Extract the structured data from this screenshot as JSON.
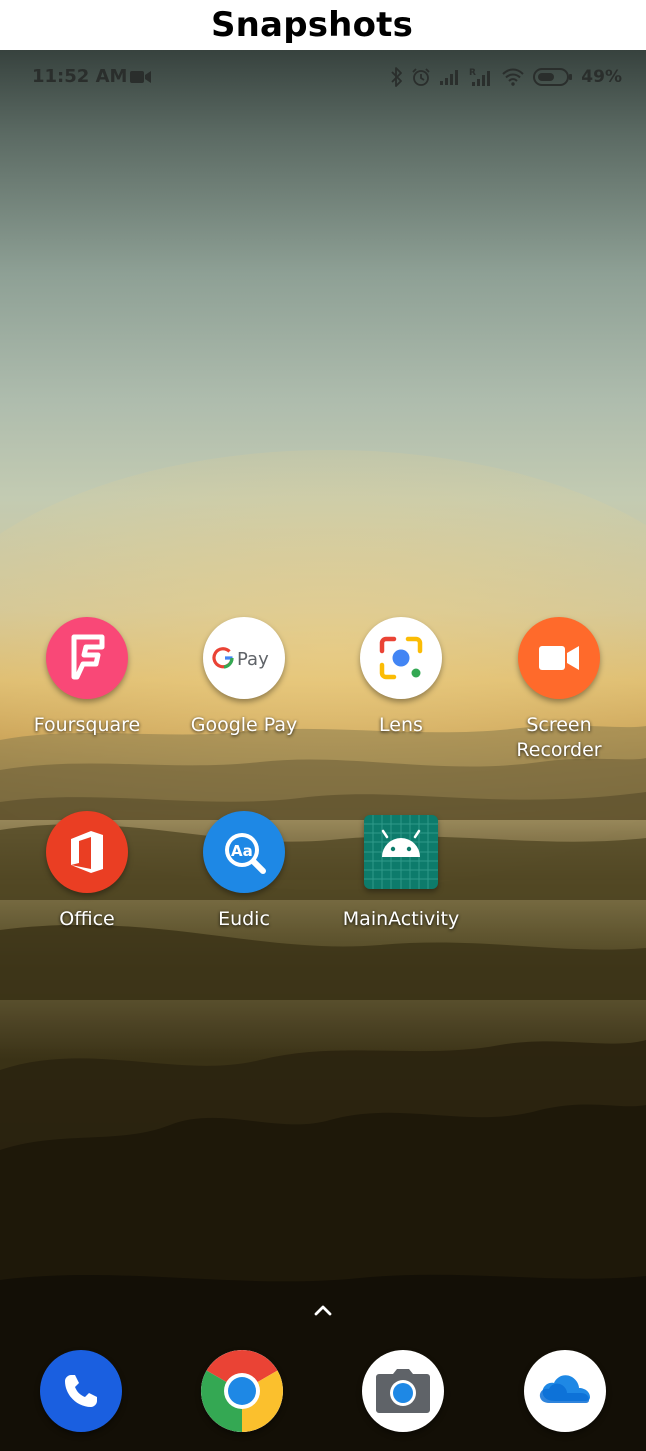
{
  "page": {
    "title": "Snapshots"
  },
  "status_bar": {
    "time": "11:52 AM",
    "battery": "49%",
    "icons": [
      "video-camera-icon",
      "bluetooth-icon",
      "alarm-icon",
      "signal-icon",
      "signal-roaming-icon",
      "wifi-icon",
      "battery-icon"
    ]
  },
  "home": {
    "apps": [
      {
        "label": "Foursquare",
        "icon": "foursquare-icon",
        "color": "#f94877"
      },
      {
        "label": "Google Pay",
        "icon": "google-pay-icon",
        "color": "#ffffff"
      },
      {
        "label": "Lens",
        "icon": "lens-icon",
        "color": "#ffffff"
      },
      {
        "label": "Screen\nRecorder",
        "icon": "screen-recorder-icon",
        "color": "#ff6a2b"
      },
      {
        "label": "Office",
        "icon": "office-icon",
        "color": "#ea3e23"
      },
      {
        "label": "Eudic",
        "icon": "eudic-icon",
        "color": "#1e88e5"
      },
      {
        "label": "MainActivity",
        "icon": "android-icon",
        "color": "#0d7b6b"
      }
    ]
  },
  "dock": {
    "apps": [
      {
        "icon": "phone-icon",
        "color": "#1a5fe0"
      },
      {
        "icon": "chrome-icon",
        "color": "#ffffff"
      },
      {
        "icon": "camera-icon",
        "color": "#ffffff"
      },
      {
        "icon": "onedrive-icon",
        "color": "#ffffff"
      }
    ]
  },
  "drawer_handle": {
    "icon": "chevron-up-icon"
  }
}
